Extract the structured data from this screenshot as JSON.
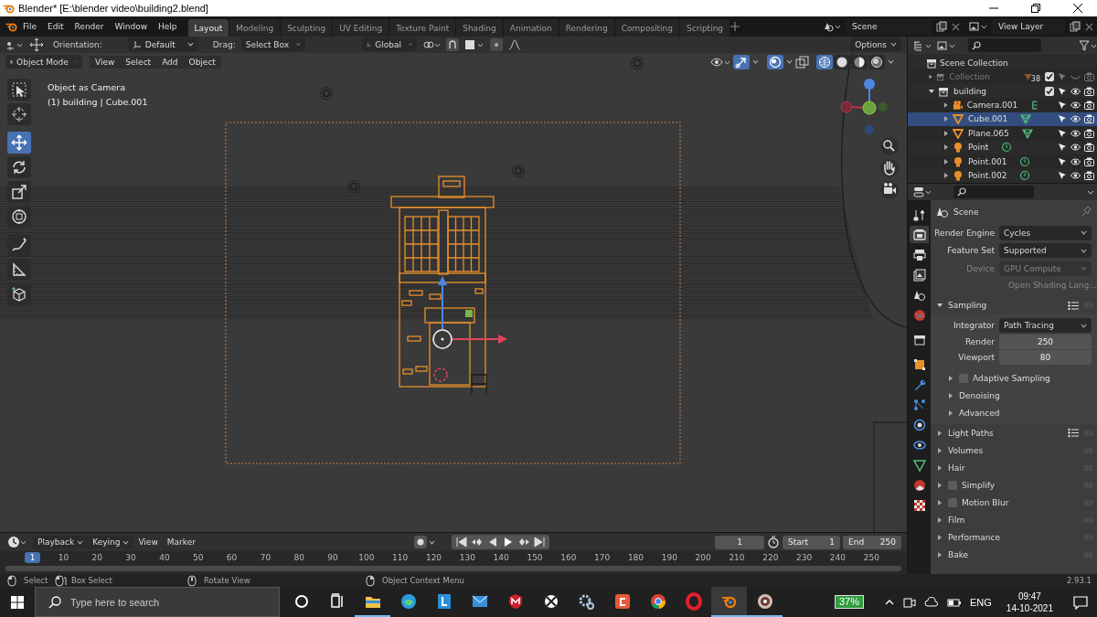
{
  "window": {
    "title": "Blender* [E:\\blender video\\building2.blend]"
  },
  "menus": [
    "File",
    "Edit",
    "Render",
    "Window",
    "Help"
  ],
  "workspaces": [
    {
      "label": "Layout",
      "selected": true
    },
    {
      "label": "Modeling",
      "selected": false
    },
    {
      "label": "Sculpting",
      "selected": false
    },
    {
      "label": "UV Editing",
      "selected": false
    },
    {
      "label": "Texture Paint",
      "selected": false
    },
    {
      "label": "Shading",
      "selected": false
    },
    {
      "label": "Animation",
      "selected": false
    },
    {
      "label": "Rendering",
      "selected": false
    },
    {
      "label": "Compositing",
      "selected": false
    },
    {
      "label": "Scripting",
      "selected": false
    }
  ],
  "scene": {
    "name": "Scene"
  },
  "view_layer": {
    "name": "View Layer"
  },
  "tool_settings": {
    "orientation_label": "Orientation:",
    "orientation": "Default",
    "drag_label": "Drag:",
    "drag": "Select Box",
    "transform_orientation": "Global",
    "options": "Options"
  },
  "viewport_header": {
    "mode": "Object Mode",
    "menus": [
      "View",
      "Select",
      "Add",
      "Object"
    ],
    "shading": [
      {
        "kind": "wireframe",
        "selected": true
      },
      {
        "kind": "solid",
        "selected": false
      },
      {
        "kind": "material",
        "selected": false
      },
      {
        "kind": "rendered",
        "selected": false
      }
    ]
  },
  "viewport": {
    "view_name": "Object as Camera",
    "object_info": "(1) building | Cube.001"
  },
  "tools": [
    {
      "kind": "select",
      "selected": false
    },
    {
      "kind": "cursor",
      "selected": false
    },
    {
      "kind": "move",
      "selected": true
    },
    {
      "kind": "rotate",
      "selected": false
    },
    {
      "kind": "scale",
      "selected": false
    },
    {
      "kind": "transform",
      "selected": false
    },
    {
      "kind": "annotate",
      "selected": false
    },
    {
      "kind": "measure",
      "selected": false
    },
    {
      "kind": "add_cube",
      "selected": false
    }
  ],
  "outliner": {
    "root": "Scene Collection",
    "items": [
      {
        "label": "Collection",
        "kind": "collection",
        "expanded": false,
        "selected": false,
        "disabled": true,
        "checked": true,
        "count": "38"
      },
      {
        "label": "building",
        "kind": "collection",
        "expanded": true,
        "selected": false,
        "disabled": false,
        "checked": true,
        "children": [
          {
            "label": "Camera.001",
            "kind": "camera",
            "expanded": false,
            "selected": false,
            "disabled": false
          },
          {
            "label": "Cube.001",
            "kind": "mesh",
            "expanded": false,
            "selected": true,
            "disabled": false
          },
          {
            "label": "Plane.065",
            "kind": "mesh",
            "expanded": false,
            "selected": false,
            "disabled": false
          },
          {
            "label": "Point",
            "kind": "light",
            "expanded": false,
            "selected": false,
            "disabled": false
          },
          {
            "label": "Point.001",
            "kind": "light",
            "expanded": false,
            "selected": false,
            "disabled": false
          },
          {
            "label": "Point.002",
            "kind": "light",
            "expanded": false,
            "selected": false,
            "disabled": false
          }
        ]
      }
    ]
  },
  "properties": {
    "tabs": [
      {
        "kind": "tool",
        "selected": false
      },
      {
        "kind": "render",
        "selected": true
      },
      {
        "kind": "output",
        "selected": false
      },
      {
        "kind": "view_layer",
        "selected": false
      },
      {
        "kind": "scene",
        "selected": false
      },
      {
        "kind": "world",
        "selected": false
      },
      {
        "kind": "collection",
        "selected": false
      },
      {
        "kind": "object",
        "selected": false
      },
      {
        "kind": "modifiers",
        "selected": false
      },
      {
        "kind": "particles",
        "selected": false
      },
      {
        "kind": "physics",
        "selected": false
      },
      {
        "kind": "constraints",
        "selected": false
      },
      {
        "kind": "data",
        "selected": false
      },
      {
        "kind": "material",
        "selected": false
      },
      {
        "kind": "texture",
        "selected": false
      }
    ],
    "context": "Scene",
    "fields": [
      {
        "label": "Render Engine",
        "value": "Cycles",
        "disabled": false
      },
      {
        "label": "Feature Set",
        "value": "Supported",
        "disabled": false
      },
      {
        "label": "Device",
        "value": "GPU Compute",
        "disabled": true
      }
    ],
    "osl": {
      "label": "Open Shading Lang...",
      "checked": false,
      "disabled": true
    },
    "panels": [
      {
        "title": "Sampling",
        "kind": "plain",
        "expanded": true,
        "presets": true,
        "integrator_label": "Integrator",
        "integrator": "Path Tracing",
        "samples": [
          {
            "label": "Render",
            "value": "250"
          },
          {
            "label": "Viewport",
            "value": "80"
          }
        ],
        "subpanels": [
          {
            "title": "Adaptive Sampling",
            "kind": "checkbox",
            "checked": false
          },
          {
            "title": "Denoising",
            "kind": "plain"
          },
          {
            "title": "Advanced",
            "kind": "plain"
          }
        ]
      },
      {
        "title": "Light Paths",
        "kind": "plain",
        "expanded": false,
        "presets": true
      },
      {
        "title": "Volumes",
        "kind": "plain",
        "expanded": false,
        "presets": false
      },
      {
        "title": "Hair",
        "kind": "plain",
        "expanded": false,
        "presets": false
      },
      {
        "title": "Simplify",
        "kind": "checkbox",
        "checked": false,
        "expanded": false,
        "presets": false
      },
      {
        "title": "Motion Blur",
        "kind": "checkbox",
        "checked": false,
        "expanded": false,
        "presets": false
      },
      {
        "title": "Film",
        "kind": "plain",
        "expanded": false,
        "presets": false
      },
      {
        "title": "Performance",
        "kind": "plain",
        "expanded": false,
        "presets": false
      },
      {
        "title": "Bake",
        "kind": "plain",
        "expanded": false,
        "presets": false
      }
    ]
  },
  "timeline": {
    "menus": [
      {
        "label": "Playback",
        "dropdown": true
      },
      {
        "label": "Keying",
        "dropdown": true
      },
      {
        "label": "View",
        "dropdown": false
      },
      {
        "label": "Marker",
        "dropdown": false
      }
    ],
    "current_frame": "1",
    "start_label": "Start",
    "start": "1",
    "end_label": "End",
    "end": "250",
    "playhead": "1",
    "ticks": [
      "10",
      "20",
      "30",
      "40",
      "50",
      "60",
      "70",
      "80",
      "90",
      "100",
      "110",
      "120",
      "130",
      "140",
      "150",
      "160",
      "170",
      "180",
      "190",
      "200",
      "210",
      "220",
      "230",
      "240",
      "250"
    ]
  },
  "status_bar": {
    "hints": [
      {
        "kind": "left_click",
        "label": "Select"
      },
      {
        "kind": "drag",
        "label": "Box Select"
      },
      {
        "kind": "middle_click",
        "label": "Rotate View"
      },
      {
        "kind": "right_click",
        "label": "Object Context Menu"
      }
    ],
    "version": "2.93.1"
  },
  "taskbar": {
    "search_placeholder": "Type here to search",
    "apps": [
      {
        "kind": "cortana",
        "running": false,
        "active": false
      },
      {
        "kind": "task_view",
        "running": false,
        "active": false
      },
      {
        "kind": "explorer",
        "running": true,
        "active": false
      },
      {
        "kind": "edge",
        "running": false,
        "active": false
      },
      {
        "kind": "tile_app",
        "running": false,
        "active": false
      },
      {
        "kind": "mail",
        "running": false,
        "active": false
      },
      {
        "kind": "shield",
        "running": false,
        "active": false
      },
      {
        "kind": "xbox",
        "running": false,
        "active": false
      },
      {
        "kind": "settings",
        "running": false,
        "active": false
      },
      {
        "kind": "rounded_app",
        "running": false,
        "active": false
      },
      {
        "kind": "chrome",
        "running": false,
        "active": false
      },
      {
        "kind": "opera",
        "running": false,
        "active": false
      },
      {
        "kind": "blender",
        "running": true,
        "active": true
      },
      {
        "kind": "disc",
        "running": true,
        "active": false
      }
    ],
    "battery": "37%",
    "language": "ENG",
    "time": "09:47",
    "date": "14-10-2021"
  }
}
